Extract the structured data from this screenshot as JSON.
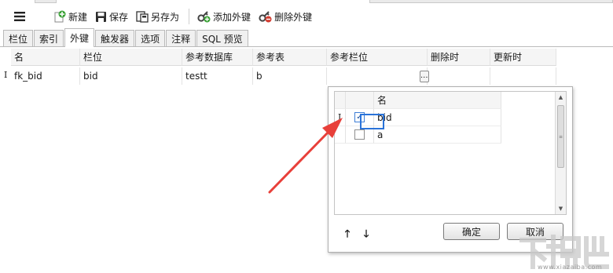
{
  "toolbar": {
    "new_label": "新建",
    "save_label": "保存",
    "save_as_label": "另存为",
    "add_fk_label": "添加外键",
    "delete_fk_label": "删除外键"
  },
  "tabs": [
    {
      "label": "栏位",
      "active": false
    },
    {
      "label": "索引",
      "active": false
    },
    {
      "label": "外键",
      "active": true
    },
    {
      "label": "触发器",
      "active": false
    },
    {
      "label": "选项",
      "active": false
    },
    {
      "label": "注释",
      "active": false
    },
    {
      "label": "SQL 预览",
      "active": false
    }
  ],
  "grid": {
    "columns": [
      "名",
      "栏位",
      "参考数据库",
      "参考表",
      "参考栏位",
      "删除时",
      "更新时"
    ],
    "rows": [
      {
        "name": "fk_bid",
        "field": "bid",
        "ref_db": "testt",
        "ref_table": "b",
        "ref_field": "",
        "on_delete": "",
        "on_update": ""
      }
    ],
    "ellipsis": "..."
  },
  "popup": {
    "column_header": "名",
    "items": [
      {
        "label": "bid",
        "checked": true
      },
      {
        "label": "a",
        "checked": false
      }
    ],
    "move_up": "🡑",
    "move_down": "🡓",
    "ok_label": "确定",
    "cancel_label": "取消"
  },
  "annotation": {
    "color": "#e8403a"
  },
  "watermark": {
    "text": "下载吧",
    "sub": "www.xiazaiba.com"
  },
  "colors": {
    "accent": "#2a73d9",
    "save_icon": "#2c2c2c",
    "add_icon": "#3aa136",
    "delete_icon": "#d23b2f"
  }
}
